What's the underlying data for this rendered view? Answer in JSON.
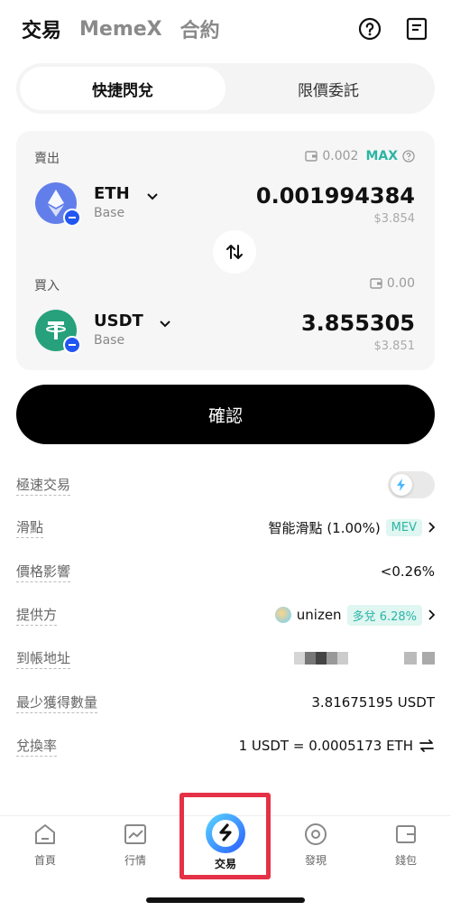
{
  "topnav": {
    "tabs": [
      "交易",
      "MemeX",
      "合約"
    ]
  },
  "mode_tabs": [
    "快捷閃兌",
    "限價委託"
  ],
  "sell": {
    "label": "賣出",
    "balance": "0.002",
    "max_label": "MAX",
    "symbol": "ETH",
    "chain": "Base",
    "amount": "0.001994384",
    "usd": "$3.854"
  },
  "buy": {
    "label": "買入",
    "balance": "0.00",
    "symbol": "USDT",
    "chain": "Base",
    "amount": "3.855305",
    "usd": "$3.851"
  },
  "confirm_label": "確認",
  "details": {
    "fast_trade": "極速交易",
    "slippage_label": "滑點",
    "slippage_value": "智能滑點 (1.00%)",
    "slippage_tag": "MEV",
    "price_impact_label": "價格影響",
    "price_impact_value": "<0.26%",
    "provider_label": "提供方",
    "provider_name": "unizen",
    "provider_tag": "多兌 6.28%",
    "address_label": "到帳地址",
    "min_received_label": "最少獲得數量",
    "min_received_value": "3.81675195 USDT",
    "rate_label": "兌換率",
    "rate_value": "1 USDT = 0.0005173 ETH"
  },
  "bottom_nav": [
    "首頁",
    "行情",
    "交易",
    "發現",
    "錢包"
  ],
  "colors": {
    "accent": "#2bb5a5",
    "eth": "#627eea",
    "usdt": "#26a17b",
    "base_chain": "#2156f0",
    "highlight": "#e53146"
  }
}
